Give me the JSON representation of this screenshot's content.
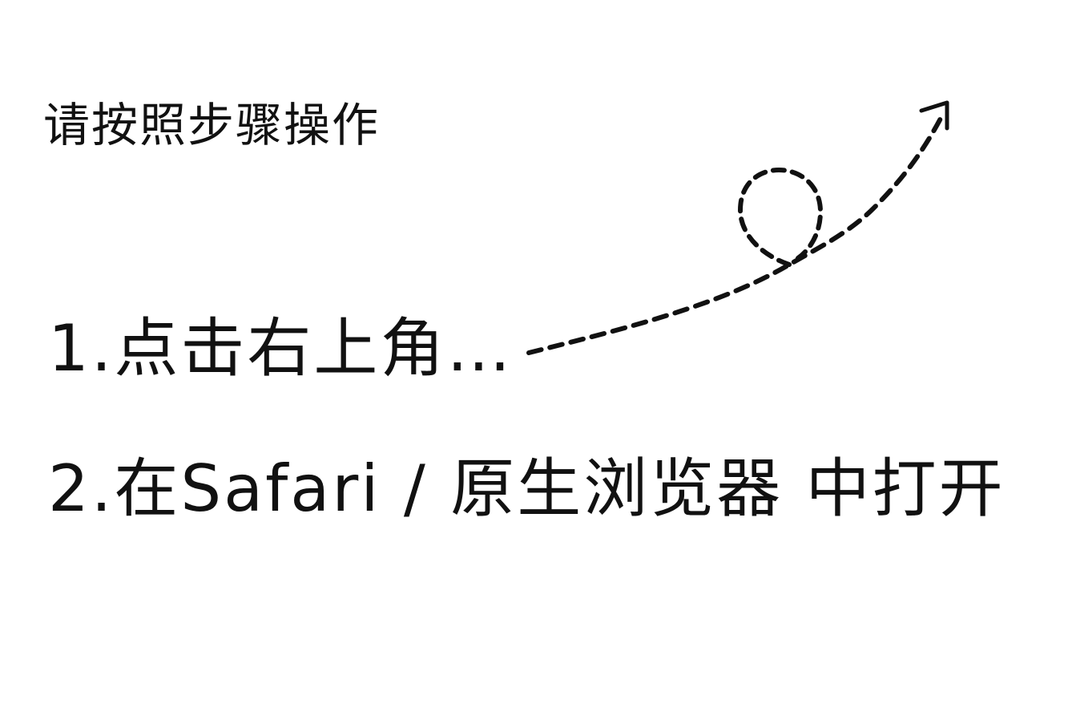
{
  "heading": "请按照步骤操作",
  "steps": [
    {
      "text": "1.点击右上角…"
    },
    {
      "text": "2.在Safari / 原生浏览器 中打开"
    }
  ],
  "colors": {
    "background": "#ffffff",
    "ink": "#111111"
  },
  "icons": {
    "arrow": "dashed-loop-arrow-icon"
  }
}
